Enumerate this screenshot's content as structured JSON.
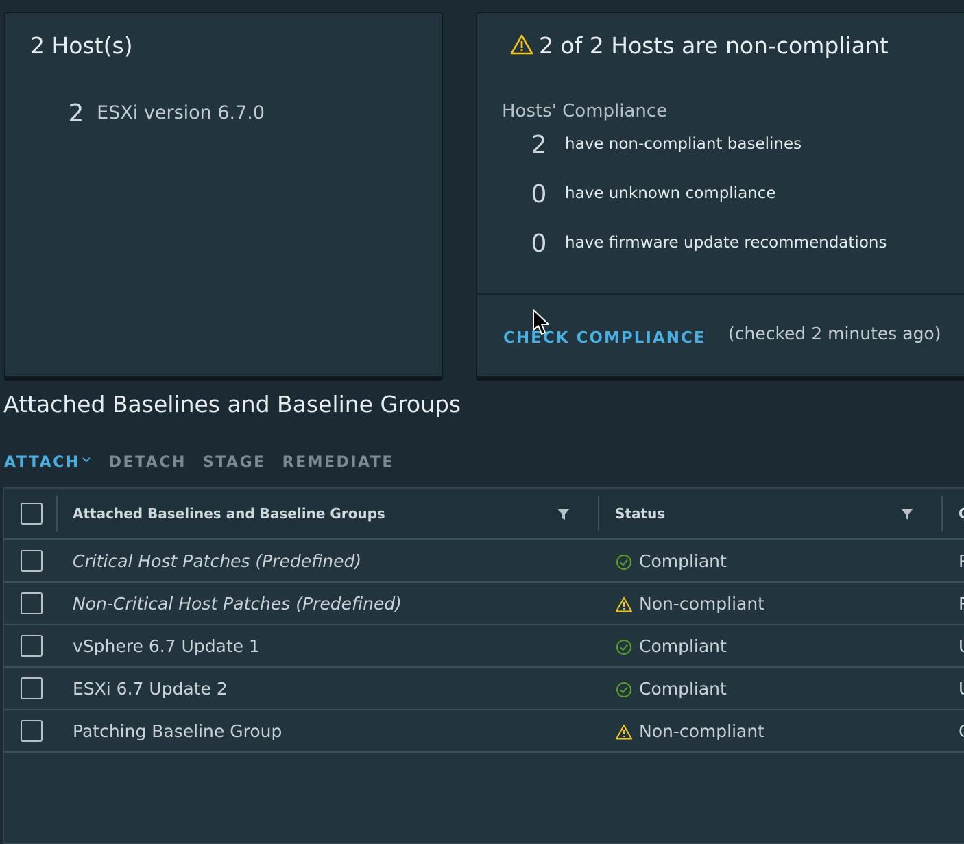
{
  "hosts_card": {
    "title": "2 Host(s)",
    "versions": [
      {
        "count": "2",
        "label": "ESXi version 6.7.0"
      }
    ]
  },
  "compliance_card": {
    "title_icon": "warning-icon",
    "title": "2 of 2 Hosts are non-compliant",
    "heading": "Hosts' Compliance",
    "rows": [
      {
        "count": "2",
        "label": "have non-compliant baselines"
      },
      {
        "count": "0",
        "label": "have unknown compliance"
      },
      {
        "count": "0",
        "label": "have firmware update recommendations"
      }
    ],
    "check_button": "CHECK COMPLIANCE",
    "checked_text": "(checked 2 minutes ago)"
  },
  "section": {
    "title": "Attached Baselines and Baseline Groups"
  },
  "toolbar": {
    "attach": "ATTACH",
    "detach": "DETACH",
    "stage": "STAGE",
    "remediate": "REMEDIATE"
  },
  "grid": {
    "columns": {
      "name": "Attached Baselines and Baseline Groups",
      "status": "Status",
      "next": "C"
    },
    "rows": [
      {
        "name": "Critical Host Patches (Predefined)",
        "italic": true,
        "status": "Compliant",
        "status_icon": "check-circle-icon",
        "extra": "P"
      },
      {
        "name": "Non-Critical Host Patches (Predefined)",
        "italic": true,
        "status": "Non-compliant",
        "status_icon": "warning-icon",
        "extra": "P"
      },
      {
        "name": "vSphere 6.7 Update 1",
        "italic": false,
        "status": "Compliant",
        "status_icon": "check-circle-icon",
        "extra": "U"
      },
      {
        "name": "ESXi 6.7 Update 2",
        "italic": false,
        "status": "Compliant",
        "status_icon": "check-circle-icon",
        "extra": "U"
      },
      {
        "name": "Patching Baseline Group",
        "italic": false,
        "status": "Non-compliant",
        "status_icon": "warning-icon",
        "extra": "C"
      }
    ]
  },
  "colors": {
    "accent": "#49aee0",
    "warning": "#f5c518",
    "success": "#5aa220",
    "background": "#1b2a33",
    "card": "#22343e"
  }
}
